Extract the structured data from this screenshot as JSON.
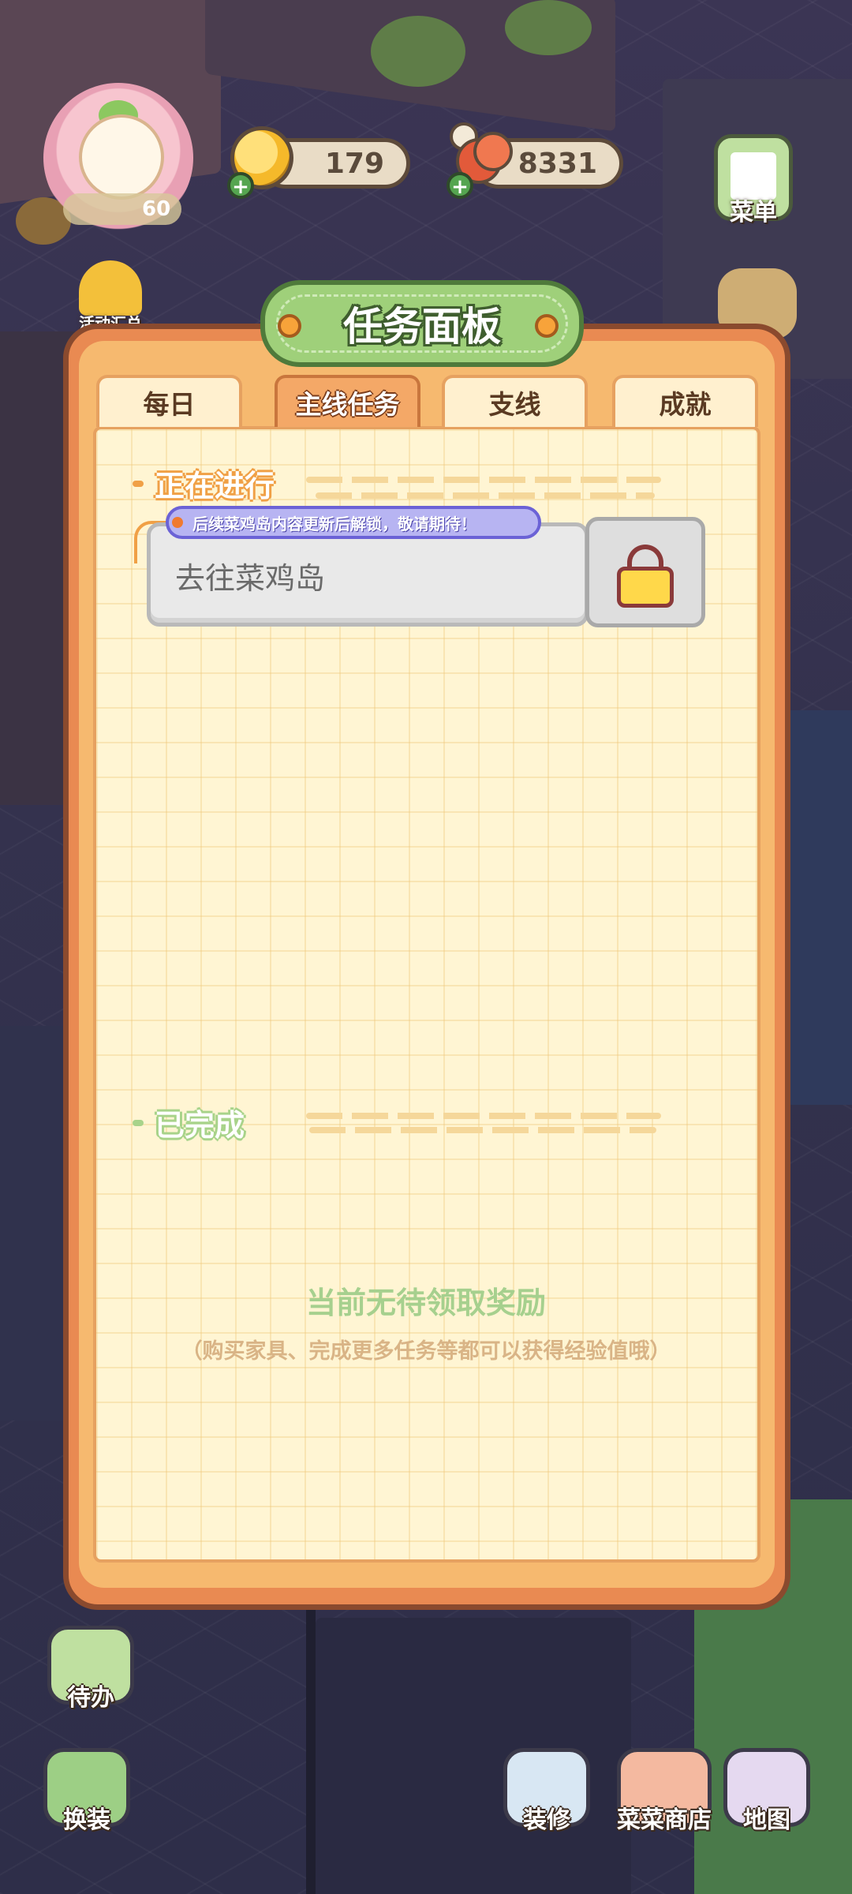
{
  "hud": {
    "level": "60",
    "coins": "179",
    "food": "8331",
    "plus": "+",
    "menu_label": "菜单",
    "events_label": "活动汇总"
  },
  "panel": {
    "title": "任务面板",
    "tabs": [
      {
        "label": "每日",
        "active": false
      },
      {
        "label": "主线任务",
        "active": true
      },
      {
        "label": "支线",
        "active": false
      },
      {
        "label": "成就",
        "active": false
      }
    ],
    "in_progress_heading": "正在进行",
    "notice": "后续菜鸡岛内容更新后解锁，敬请期待！",
    "task_name": "去往菜鸡岛",
    "completed_heading": "已完成",
    "empty_title": "当前无待领取奖励",
    "empty_subtitle": "（购买家具、完成更多任务等都可以获得经验值哦）"
  },
  "bottom": {
    "todo": "待办",
    "dress": "换装",
    "decorate": "装修",
    "shop": "菜菜商店",
    "map": "地图"
  },
  "colors": {
    "panel_orange": "#e98a52",
    "title_green": "#9fd07a",
    "paper": "#fff5d3",
    "notice_purple": "#b7b4f2"
  },
  "icons": [
    "coin-icon",
    "food-icon",
    "menu-icon",
    "lock-icon",
    "todo-icon",
    "dress-icon",
    "decorate-icon",
    "shop-icon",
    "map-icon"
  ]
}
